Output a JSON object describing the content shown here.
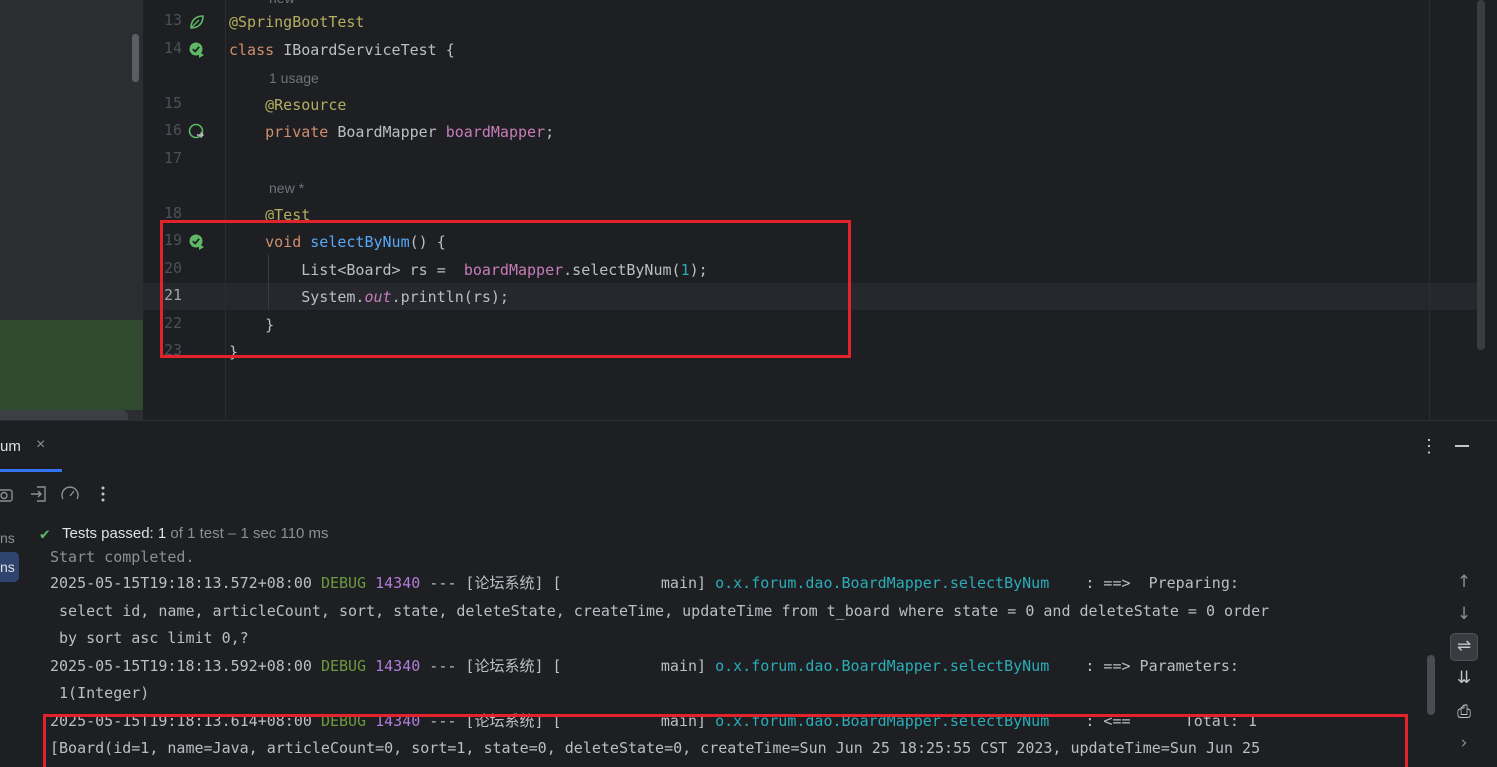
{
  "editor": {
    "lines": [
      {
        "num": "13",
        "tokens": [
          {
            "t": "@SpringBootTest",
            "c": "ann"
          }
        ]
      },
      {
        "num": "14",
        "tokens": [
          {
            "t": "class ",
            "c": "kw"
          },
          {
            "t": "IBoardServiceTest {",
            "c": "plain"
          }
        ]
      },
      {
        "num": "15",
        "tokens": [
          {
            "t": "    @Resource",
            "c": "ann"
          }
        ]
      },
      {
        "num": "16",
        "tokens": [
          {
            "t": "    private ",
            "c": "kw"
          },
          {
            "t": "BoardMapper ",
            "c": "plain"
          },
          {
            "t": "boardMapper",
            "c": "fld"
          },
          {
            "t": ";",
            "c": "plain"
          }
        ]
      },
      {
        "num": "17",
        "tokens": []
      },
      {
        "num": "18",
        "tokens": [
          {
            "t": "    @Test",
            "c": "ann"
          }
        ]
      },
      {
        "num": "19",
        "tokens": [
          {
            "t": "    void ",
            "c": "kw"
          },
          {
            "t": "selectByNum",
            "c": "fn"
          },
          {
            "t": "() {",
            "c": "plain"
          }
        ]
      },
      {
        "num": "20",
        "tokens": [
          {
            "t": "        List<Board> rs =  ",
            "c": "plain"
          },
          {
            "t": "boardMapper",
            "c": "fld"
          },
          {
            "t": ".selectByNum(",
            "c": "plain"
          },
          {
            "t": "1",
            "c": "num"
          },
          {
            "t": ");",
            "c": "plain"
          }
        ]
      },
      {
        "num": "21",
        "tokens": [
          {
            "t": "        System.",
            "c": "plain"
          },
          {
            "t": "out",
            "c": "ital"
          },
          {
            "t": ".println(rs);",
            "c": "plain"
          }
        ]
      },
      {
        "num": "22",
        "tokens": [
          {
            "t": "    }",
            "c": "plain"
          }
        ]
      },
      {
        "num": "23",
        "tokens": [
          {
            "t": "}",
            "c": "plain"
          }
        ]
      }
    ],
    "hints": {
      "top": "new",
      "usage": "1 usage",
      "new_star": "new *"
    },
    "active_line": "21"
  },
  "run_panel": {
    "tab_label": "um",
    "close_glyph": "×",
    "more_glyph": "⋮",
    "tree": {
      "item1": "ns",
      "item2": "ns"
    },
    "status": {
      "check": "✔",
      "passed": "Tests passed: ",
      "count": "1",
      "rest": " of 1 test – 1 sec 110 ms"
    },
    "console": [
      {
        "type": "partial",
        "text": "Start completed."
      },
      {
        "type": "log",
        "ts": "2025-05-15T19:18:13.572+08:00",
        "level": "DEBUG",
        "pid": "14340",
        "mid": " --- [论坛系统] [           main] ",
        "cls": "o.x.forum.dao.BoardMapper.selectByNum",
        "tail": "    : ==>  Preparing:"
      },
      {
        "type": "cont",
        "text": " select id, name, articleCount, sort, state, deleteState, createTime, updateTime from t_board where state = 0 and deleteState = 0 order"
      },
      {
        "type": "cont",
        "text": " by sort asc limit 0,?"
      },
      {
        "type": "log",
        "ts": "2025-05-15T19:18:13.592+08:00",
        "level": "DEBUG",
        "pid": "14340",
        "mid": " --- [论坛系统] [           main] ",
        "cls": "o.x.forum.dao.BoardMapper.selectByNum",
        "tail": "    : ==> Parameters:"
      },
      {
        "type": "cont",
        "text": " 1(Integer)"
      },
      {
        "type": "log",
        "ts": "2025-05-15T19:18:13.614+08:00",
        "level": "DEBUG",
        "pid": "14340",
        "mid": " --- [论坛系统] [           main] ",
        "cls": "o.x.forum.dao.BoardMapper.selectByNum",
        "tail": "    : <==      Total: 1"
      },
      {
        "type": "cont",
        "text": "[Board(id=1, name=Java, articleCount=0, sort=1, state=0, deleteState=0, createTime=Sun Jun 25 18:25:55 CST 2023, updateTime=Sun Jun 25"
      }
    ],
    "side_tools": [
      "↑",
      "↓",
      "⇌",
      "⇊",
      "⎙",
      "›"
    ]
  },
  "colors": {
    "highlight_box": "#e3232c",
    "test_pass": "#5fb865",
    "tab_accent": "#3574f0"
  }
}
